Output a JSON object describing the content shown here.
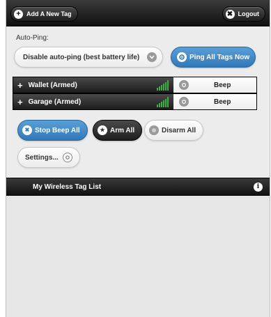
{
  "topbar": {
    "add_tag_label": "Add A New Tag",
    "add_icon": "plus-icon",
    "logout_label": "Logout",
    "logout_icon": "close-icon"
  },
  "autoping": {
    "label": "Auto-Ping:",
    "selected_option": "Disable auto-ping (best battery life)",
    "ping_all_label": "Ping All Tags Now"
  },
  "tags": [
    {
      "name": "Wallet (Armed)",
      "action_label": "Beep"
    },
    {
      "name": "Garage (Armed)",
      "action_label": "Beep"
    }
  ],
  "actions": {
    "stop_beep_label": "Stop Beep All",
    "arm_all_label": "Arm All",
    "disarm_all_label": "Disarm All",
    "settings_label": "Settings..."
  },
  "list_header": {
    "title": "My Wireless Tag List"
  },
  "colors": {
    "accent_blue": "#3a82c4",
    "dark_bar": "#1c1c1c",
    "signal_green": "#3cb043"
  }
}
